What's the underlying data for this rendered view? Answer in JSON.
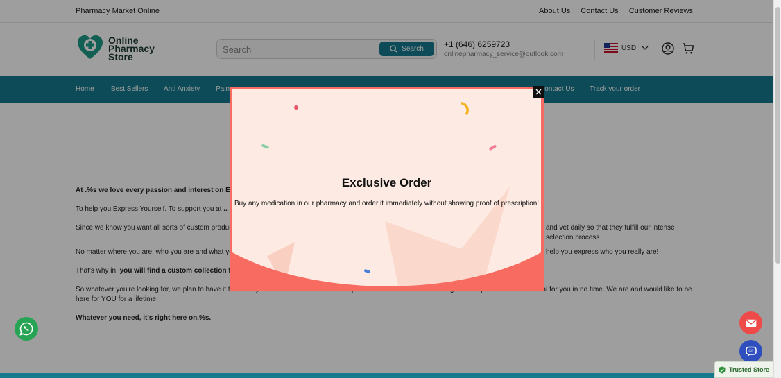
{
  "topbar": {
    "brand": "Pharmacy Market Online",
    "links": [
      "About Us",
      "Contact Us",
      "Customer Reviews"
    ]
  },
  "header": {
    "logo_text": "Online Pharmacy Store",
    "search_placeholder": "Search",
    "search_button": "Search",
    "phone": "+1 (646) 6259723",
    "email": "onlinepharmacy_service@outlook.com",
    "currency": "USD"
  },
  "nav": {
    "items": [
      "Home",
      "Best Sellers",
      "Anti Anxiety",
      "Pain",
      "Contact Us",
      "Track your order"
    ]
  },
  "content": {
    "p1": "At .%s we love every passion and interest on Earth",
    "p2a": "To help you Express Yourself. To support you at ",
    "p2b": "..",
    "p3": "Since we know you want all sorts of custom products,",
    "p3b": "and vet daily so that they fulfill our intense selection process.",
    "p4": "No matter where you are, who you are and what you a",
    "p4b": "help you express who you really are!",
    "p5a": "That's why in. ",
    "p5b": "you will find a custom collection for e",
    "p6": "So whatever you're looking for, we plan to have it there for you. And if it's not, then hit us up and let us know, so we can negotiate or produce the best deal for you in no time. We are and would like to be here for YOU for a lifetime.",
    "p7": "Whatever you need, it's right here on.%s."
  },
  "modal": {
    "title": "Exclusive Order",
    "message": "Buy any medication in our pharmacy and order it immediately without showing proof of prescription!"
  },
  "widgets": {
    "trusted": "Trusted Store"
  },
  "colors": {
    "primary": "#157a8e",
    "modal_border": "#f86b61",
    "modal_bg": "#fdebe3",
    "whatsapp": "#26a453",
    "mail": "#ee4a4a",
    "chat": "#2f4fbf"
  }
}
